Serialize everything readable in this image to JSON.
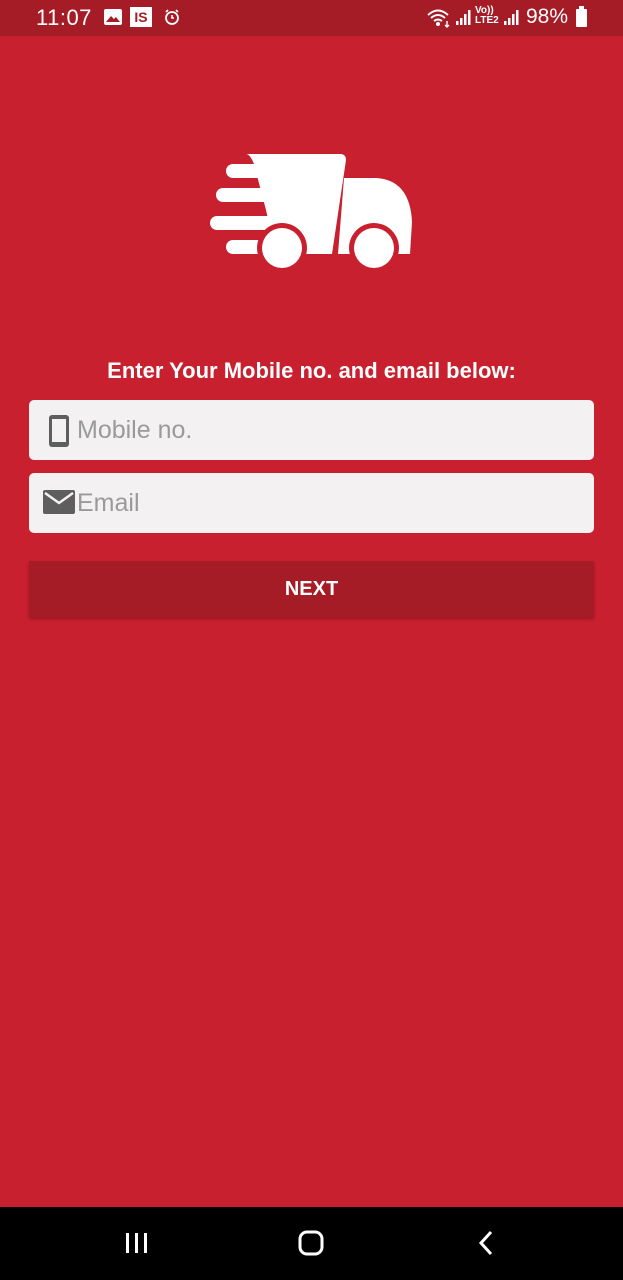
{
  "status_bar": {
    "time": "11:07",
    "battery": "98%",
    "network_label": "Vo)) LTE2",
    "icons": [
      "gallery-icon",
      "is-app-icon",
      "alarm-icon",
      "wifi-icon",
      "signal-icon",
      "battery-icon"
    ],
    "is_label": "IS"
  },
  "logo": {
    "icon": "delivery-truck-icon"
  },
  "form": {
    "prompt": "Enter Your Mobile no. and email below:",
    "mobile": {
      "placeholder": "Mobile no.",
      "value": "",
      "icon": "phone-icon"
    },
    "email": {
      "placeholder": "Email",
      "value": "",
      "icon": "mail-icon"
    },
    "next_label": "NEXT"
  },
  "nav_bar": {
    "buttons": [
      "recent-apps",
      "home",
      "back"
    ]
  },
  "colors": {
    "background": "#c8202f",
    "status_bar": "#a51c27",
    "button": "#a51c27",
    "field": "#f3f1f2",
    "placeholder": "#9a9a9a"
  }
}
